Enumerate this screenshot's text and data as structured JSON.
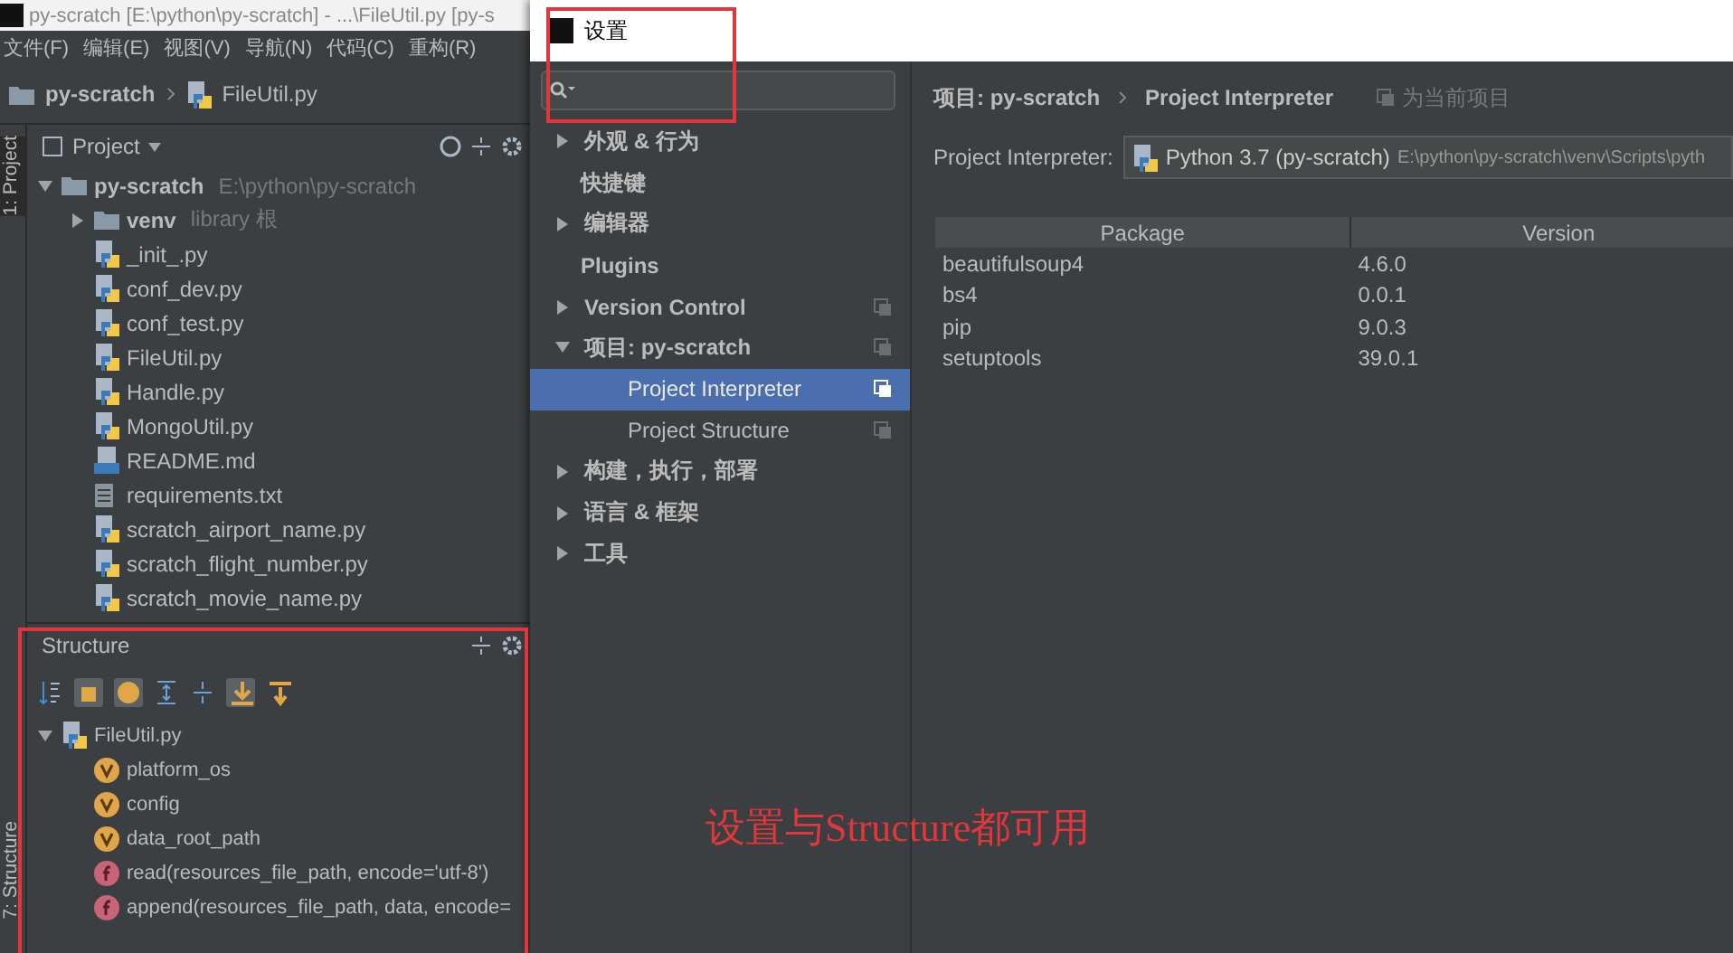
{
  "ide": {
    "title": "py-scratch [E:\\python\\py-scratch] - ...\\FileUtil.py [py-s",
    "menu": [
      "文件(F)",
      "编辑(E)",
      "视图(V)",
      "导航(N)",
      "代码(C)",
      "重构(R)"
    ],
    "breadcrumb": [
      {
        "label": "py-scratch",
        "kind": "folder"
      },
      {
        "label": "FileUtil.py",
        "kind": "python"
      }
    ],
    "side_tabs": [
      "1: Project",
      "7: Structure"
    ],
    "project_panel": {
      "title": "Project",
      "tree": [
        {
          "label": "py-scratch",
          "path": "E:\\python\\py-scratch",
          "kind": "folder",
          "expanded": true,
          "children": [
            {
              "label": "venv",
              "path": "library 根",
              "kind": "folder",
              "expanded": false
            },
            {
              "label": "_init_.py",
              "kind": "python"
            },
            {
              "label": "conf_dev.py",
              "kind": "python"
            },
            {
              "label": "conf_test.py",
              "kind": "python"
            },
            {
              "label": "FileUtil.py",
              "kind": "python"
            },
            {
              "label": "Handle.py",
              "kind": "python"
            },
            {
              "label": "MongoUtil.py",
              "kind": "python"
            },
            {
              "label": "README.md",
              "kind": "markdown"
            },
            {
              "label": "requirements.txt",
              "kind": "text"
            },
            {
              "label": "scratch_airport_name.py",
              "kind": "python"
            },
            {
              "label": "scratch_flight_number.py",
              "kind": "python"
            },
            {
              "label": "scratch_movie_name.py",
              "kind": "python"
            }
          ]
        }
      ]
    },
    "structure_panel": {
      "title": "Structure",
      "tree": [
        {
          "label": "FileUtil.py",
          "kind": "python",
          "expanded": true,
          "children": [
            {
              "label": "platform_os",
              "kind": "variable"
            },
            {
              "label": "config",
              "kind": "variable"
            },
            {
              "label": "data_root_path",
              "kind": "variable"
            },
            {
              "label": "read(resources_file_path, encode='utf-8')",
              "kind": "function"
            },
            {
              "label": "append(resources_file_path, data, encode=",
              "kind": "function"
            }
          ]
        }
      ]
    }
  },
  "settings": {
    "title": "设置",
    "nav": [
      {
        "label": "外观 & 行为",
        "expanded": false,
        "selected": false
      },
      {
        "label": "快捷键",
        "selected": false
      },
      {
        "label": "编辑器",
        "expanded": false,
        "selected": false
      },
      {
        "label": "Plugins",
        "selected": false
      },
      {
        "label": "Version Control",
        "expanded": false,
        "project_level": true,
        "selected": false
      },
      {
        "label": "项目: py-scratch",
        "expanded": true,
        "project_level": true,
        "selected": false,
        "children": [
          {
            "label": "Project Interpreter",
            "project_level": true,
            "selected": true
          },
          {
            "label": "Project Structure",
            "project_level": true,
            "selected": false
          }
        ]
      },
      {
        "label": "构建，执行，部署",
        "expanded": false,
        "selected": false
      },
      {
        "label": "语言 & 框架",
        "expanded": false,
        "selected": false
      },
      {
        "label": "工具",
        "expanded": false,
        "selected": false
      }
    ],
    "breadcrumb": [
      "项目: py-scratch",
      "Project Interpreter"
    ],
    "scope_note": "为当前项目",
    "interpreter": {
      "label": "Project Interpreter:",
      "name": "Python 3.7 (py-scratch)",
      "path": "E:\\python\\py-scratch\\venv\\Scripts\\pyth"
    },
    "table": {
      "columns": [
        "Package",
        "Version"
      ],
      "rows": [
        [
          "beautifulsoup4",
          "4.6.0"
        ],
        [
          "bs4",
          "0.0.1"
        ],
        [
          "pip",
          "9.0.3"
        ],
        [
          "setuptools",
          "39.0.1"
        ]
      ]
    }
  },
  "annotation": "设置与Structure都可用"
}
